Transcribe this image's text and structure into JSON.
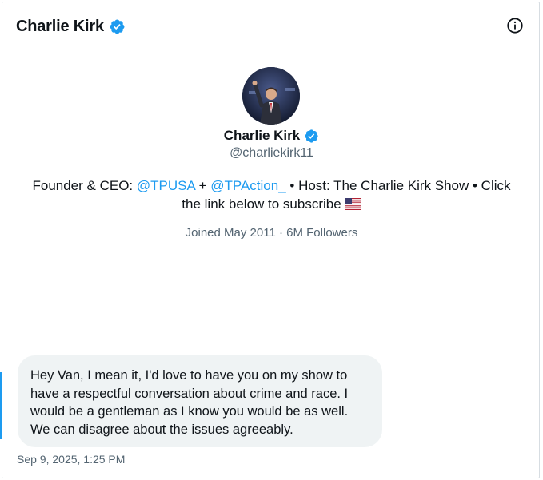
{
  "header": {
    "name": "Charlie Kirk",
    "verified_icon": "verified-badge-icon",
    "info_icon": "info-icon"
  },
  "profile": {
    "name": "Charlie Kirk",
    "handle": "@charliekirk11",
    "bio": {
      "prefix": "Founder & CEO: ",
      "mention1": "@TPUSA",
      "joiner": " + ",
      "mention2": "@TPAction_",
      "suffix": " • Host: The Charlie Kirk Show • Click the link below to subscribe",
      "flag_icon": "us-flag-icon"
    },
    "joined": "Joined May 2011",
    "separator": " · ",
    "followers": "6M Followers"
  },
  "message": {
    "text": "Hey Van, I mean it, I'd love to have you on my show to have a respectful conversation about crime and race. I would be a gentleman as I know you would be as well. We can disagree about the issues agreeably.",
    "timestamp": "Sep 9, 2025, 1:25 PM"
  },
  "colors": {
    "accent": "#1d9bf0",
    "text": "#0f1419",
    "secondary": "#536471",
    "bubble": "#eff3f4"
  }
}
